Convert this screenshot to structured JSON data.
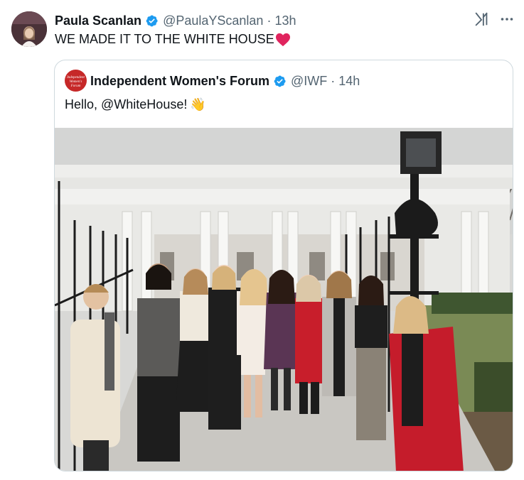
{
  "tweet": {
    "author_name": "Paula Scanlan",
    "handle": "@PaulaYScanlan",
    "separator": "·",
    "time": "13h",
    "text": "WE MADE IT TO THE WHITE HOUSE",
    "text_emoji": "red-heart-emoji"
  },
  "quote": {
    "avatar_label": "Independent Women's Forum",
    "author_name": "Independent Women's Forum",
    "handle": "@IWF",
    "separator": "·",
    "time": "14h",
    "text": "Hello, @WhiteHouse!",
    "emoji": "👋",
    "photo_description_icon": "group-photo-image"
  },
  "icons": {
    "verified": "verified-badge-icon",
    "grok": "grok-icon",
    "more": "more-icon"
  },
  "colors": {
    "verified_blue": "#1d9bf0",
    "heart_red": "#e0245e",
    "iwf_red": "#c62828",
    "muted_text": "#536471",
    "border": "#cfd9de"
  }
}
